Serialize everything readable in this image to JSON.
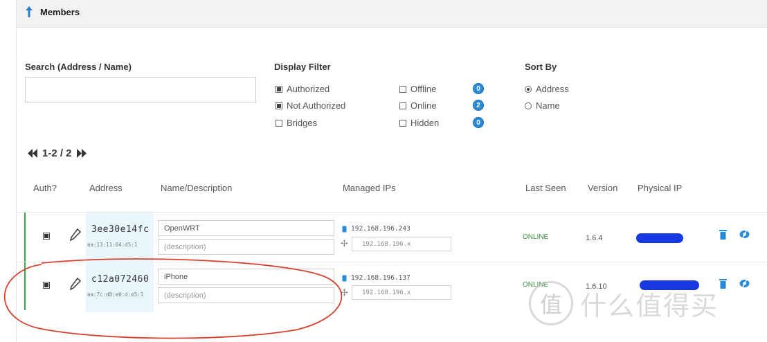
{
  "header": {
    "title": "Members"
  },
  "search": {
    "label": "Search (Address / Name)",
    "placeholder": ""
  },
  "display_filter": {
    "label": "Display Filter",
    "options": [
      {
        "label": "Authorized",
        "checked": true
      },
      {
        "label": "Not Authorized",
        "checked": true
      },
      {
        "label": "Bridges",
        "checked": false
      },
      {
        "label": "Offline",
        "checked": false,
        "count": "0"
      },
      {
        "label": "Online",
        "checked": false,
        "count": "2"
      },
      {
        "label": "Hidden",
        "checked": false,
        "count": "0"
      }
    ]
  },
  "sort_by": {
    "label": "Sort By",
    "options": [
      {
        "label": "Address",
        "selected": true
      },
      {
        "label": "Name",
        "selected": false
      }
    ]
  },
  "pager": {
    "text": "1-2 / 2"
  },
  "table": {
    "headers": [
      "Auth?",
      "Address",
      "Name/Description",
      "Managed IPs",
      "Last Seen",
      "Version",
      "Physical IP"
    ],
    "rows": [
      {
        "address": "3ee30e14fc",
        "address_sub": "ea:13:11:04:d5:1",
        "name": "OpenWRT",
        "description_placeholder": "(description)",
        "managed_ip": "192.168.196.243",
        "ip_placeholder": "192.168.196.x",
        "last_seen": "ONLINE",
        "version": "1.6.4"
      },
      {
        "address": "c12a072460",
        "address_sub": "ea:7c:d8:e0:d:e5:1",
        "name": "iPhone",
        "description_placeholder": "(description)",
        "managed_ip": "192.168.196.137",
        "ip_placeholder": "192.168.196.x",
        "last_seen": "ONLINE",
        "version": "1.6.10"
      }
    ]
  },
  "watermark": {
    "badge": "值",
    "text": "什么值得买"
  },
  "colors": {
    "accent": "#2a8ad8",
    "online": "#3a8f3e",
    "annotation": "#d9412f",
    "redaction": "#1838e0",
    "row_bar": "#3aa845"
  }
}
